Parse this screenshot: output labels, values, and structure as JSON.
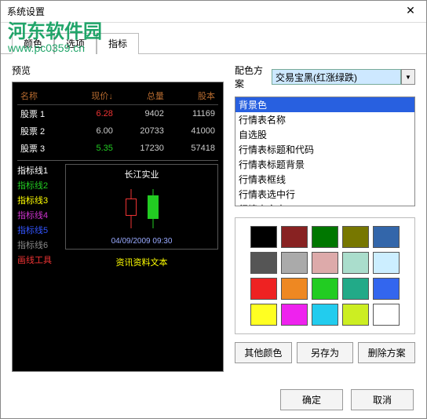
{
  "window": {
    "title": "系统设置",
    "close": "✕"
  },
  "watermark": {
    "main": "河东软件园",
    "sub": "www.pc0359.cn"
  },
  "tabs": {
    "t0": "颜色",
    "t1": "选项",
    "t2": "指标"
  },
  "preview": {
    "label": "预览",
    "headers": {
      "name": "名称",
      "price": "现价↓",
      "volume": "总量",
      "shares": "股本"
    },
    "rows": [
      {
        "name": "股票 1",
        "price": "6.28",
        "dir": "up",
        "volume": "9402",
        "shares": "11169"
      },
      {
        "name": "股票 2",
        "price": "6.00",
        "dir": "flat",
        "volume": "20733",
        "shares": "41000"
      },
      {
        "name": "股票 3",
        "price": "5.35",
        "dir": "down",
        "volume": "17230",
        "shares": "57418"
      }
    ],
    "indicators": [
      {
        "label": "指标线1",
        "color": "#ffffff"
      },
      {
        "label": "指标线2",
        "color": "#22cc22"
      },
      {
        "label": "指标线3",
        "color": "#ffff00"
      },
      {
        "label": "指标线4",
        "color": "#cc33cc"
      },
      {
        "label": "指标线5",
        "color": "#3355ff"
      },
      {
        "label": "指标线6",
        "color": "#888888"
      },
      {
        "label": "画线工具",
        "color": "#ee3333"
      }
    ],
    "chart": {
      "title": "长江实业",
      "date": "04/09/2009 09:30"
    },
    "info_text": "资讯资料文本"
  },
  "scheme": {
    "label": "配色方案",
    "value": "交易宝黑(红涨绿跌)",
    "items": [
      "背景色",
      "行情表名称",
      "自选股",
      "行情表标题和代码",
      "行情表标题背景",
      "行情表框线",
      "行情表选中行",
      "行情表文本"
    ]
  },
  "palette": [
    "#000000",
    "#882222",
    "#007700",
    "#777700",
    "#3366aa",
    "#555555",
    "#aaaaaa",
    "#ddaaaa",
    "#aaddcc",
    "#cceeff",
    "#ee2222",
    "#ee8822",
    "#22cc22",
    "#22aa88",
    "#3366ee",
    "#ffff22",
    "#ee22ee",
    "#22ccee",
    "#ccee22",
    "#ffffff"
  ],
  "buttons": {
    "other": "其他颜色",
    "saveas": "另存为",
    "delete": "删除方案",
    "ok": "确定",
    "cancel": "取消"
  }
}
